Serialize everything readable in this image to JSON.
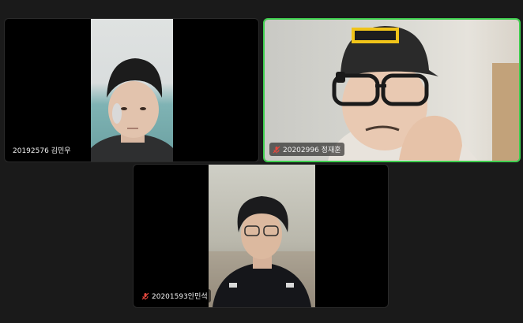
{
  "participants": [
    {
      "name": "20192576 김민우",
      "muted": false,
      "active_speaker": false
    },
    {
      "name": "20202996 정재훈",
      "muted": true,
      "active_speaker": true
    },
    {
      "name": "20201593안민석",
      "muted": true,
      "active_speaker": false
    }
  ],
  "colors": {
    "background": "#1a1a1a",
    "active_border": "#3fcf4f",
    "mute_icon": "#e5483e"
  }
}
